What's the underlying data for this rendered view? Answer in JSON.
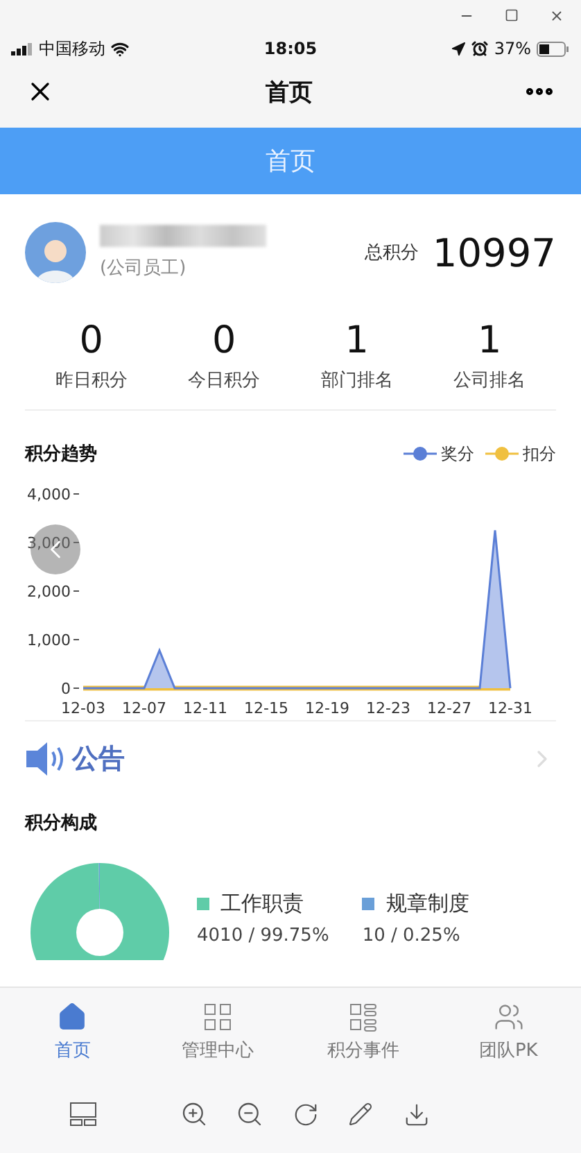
{
  "status_bar": {
    "carrier": "中国移动",
    "time": "18:05",
    "battery": "37%"
  },
  "nav_bar": {
    "title": "首页"
  },
  "page_header": {
    "title": "首页"
  },
  "profile": {
    "role": "(公司员工)",
    "total_label": "总积分",
    "total": "10997"
  },
  "stats": [
    {
      "value": "0",
      "label": "昨日积分"
    },
    {
      "value": "0",
      "label": "今日积分"
    },
    {
      "value": "1",
      "label": "部门排名"
    },
    {
      "value": "1",
      "label": "公司排名"
    }
  ],
  "trend": {
    "title": "积分趋势",
    "chart_data": {
      "type": "line",
      "categories": [
        "12-03",
        null,
        null,
        null,
        "12-07",
        null,
        null,
        null,
        "12-11",
        null,
        null,
        null,
        "12-15",
        null,
        null,
        null,
        "12-19",
        null,
        null,
        null,
        "12-23",
        null,
        null,
        null,
        "12-27",
        null,
        null,
        null,
        "12-31"
      ],
      "series": [
        {
          "name": "奖分",
          "color": "#5b7fd6",
          "values": [
            0,
            0,
            0,
            0,
            0,
            780,
            0,
            0,
            0,
            0,
            0,
            0,
            0,
            0,
            0,
            0,
            0,
            0,
            0,
            0,
            0,
            0,
            0,
            0,
            0,
            0,
            0,
            3250,
            0
          ]
        },
        {
          "name": "扣分",
          "color": "#f0c040",
          "values": [
            0,
            0,
            0,
            0,
            0,
            0,
            0,
            0,
            0,
            0,
            0,
            0,
            0,
            0,
            0,
            0,
            0,
            0,
            0,
            0,
            0,
            0,
            0,
            0,
            0,
            0,
            0,
            0,
            0
          ]
        }
      ],
      "ylim": [
        0,
        4000
      ],
      "yticks": [
        {
          "value": 0,
          "label": "0"
        },
        {
          "value": 1000,
          "label": "1,000"
        },
        {
          "value": 2000,
          "label": "2,000"
        },
        {
          "value": 3000,
          "label": "3,000"
        },
        {
          "value": 4000,
          "label": "4,000"
        }
      ]
    }
  },
  "notice": {
    "title": "公告"
  },
  "composition": {
    "title": "积分构成",
    "legend": [
      {
        "name": "工作职责",
        "detail": "4010 / 99.75%",
        "color": "#5fcca8"
      },
      {
        "name": "规章制度",
        "detail": "10 / 0.25%",
        "color": "#6a9fd8"
      }
    ],
    "chart_data": {
      "type": "donut",
      "values": [
        99.75,
        0.25
      ]
    }
  },
  "tab_bar": [
    {
      "label": "首页",
      "selected": true,
      "kind": "home"
    },
    {
      "label": "管理中心",
      "selected": false,
      "kind": "grid"
    },
    {
      "label": "积分事件",
      "selected": false,
      "kind": "list"
    },
    {
      "label": "团队PK",
      "selected": false,
      "kind": "team"
    }
  ]
}
